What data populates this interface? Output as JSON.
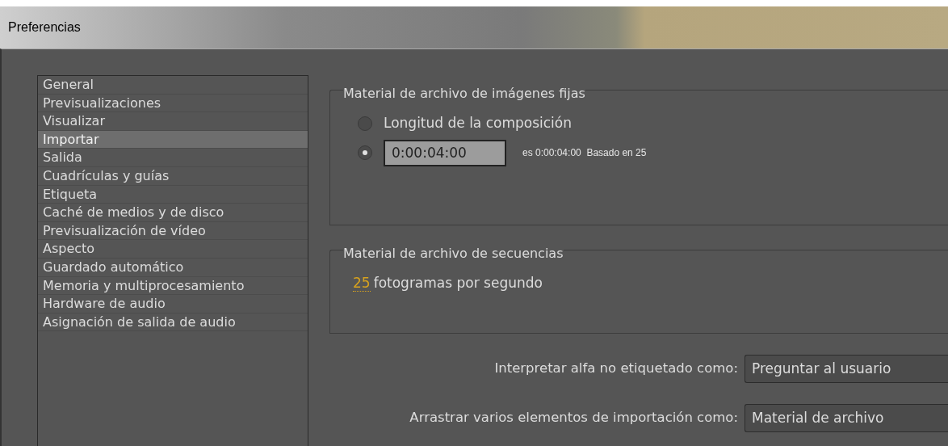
{
  "window": {
    "title": "Preferencias"
  },
  "sidebar": {
    "items": [
      {
        "label": "General",
        "selected": false
      },
      {
        "label": "Previsualizaciones",
        "selected": false
      },
      {
        "label": "Visualizar",
        "selected": false
      },
      {
        "label": "Importar",
        "selected": true
      },
      {
        "label": "Salida",
        "selected": false
      },
      {
        "label": "Cuadrículas y guías",
        "selected": false
      },
      {
        "label": "Etiqueta",
        "selected": false
      },
      {
        "label": "Caché de medios y de disco",
        "selected": false
      },
      {
        "label": "Previsualización de vídeo",
        "selected": false
      },
      {
        "label": "Aspecto",
        "selected": false
      },
      {
        "label": "Guardado automático",
        "selected": false
      },
      {
        "label": "Memoria y multiprocesamiento",
        "selected": false
      },
      {
        "label": "Hardware de audio",
        "selected": false
      },
      {
        "label": "Asignación de salida de audio",
        "selected": false
      }
    ]
  },
  "still_footage": {
    "title": "Material de archivo de imágenes fijas",
    "options": [
      {
        "kind": "label",
        "label": "Longitud de la composición",
        "selected": false
      },
      {
        "kind": "duration",
        "value": "0:00:04:00",
        "note": "es 0:00:04:00  Basado en 25",
        "selected": true
      }
    ]
  },
  "sequence_footage": {
    "title": "Material de archivo de secuencias",
    "rate": "25",
    "unit": "fotogramas por segundo"
  },
  "dropdowns": [
    {
      "label": "Interpretar alfa no etiquetado como:",
      "value": "Preguntar al usuario"
    },
    {
      "label": "Arrastrar varios elementos de importación como:",
      "value": "Material de archivo"
    }
  ]
}
